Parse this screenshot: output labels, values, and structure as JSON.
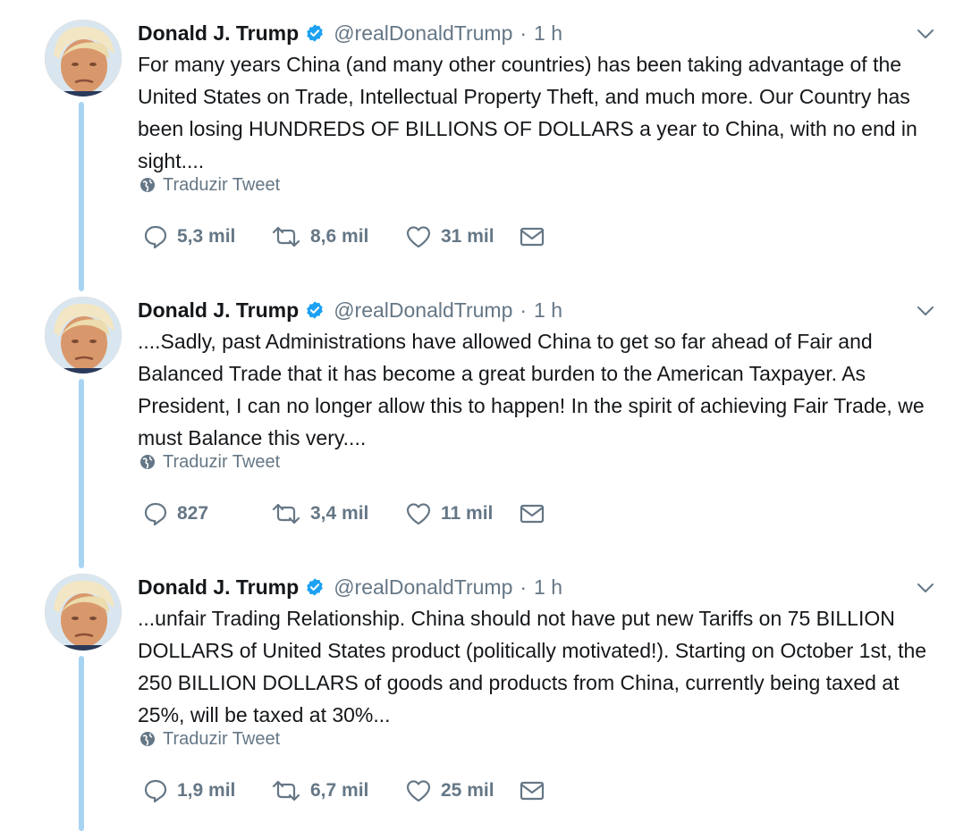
{
  "colors": {
    "thread_line": "#a8d4f3",
    "verified": "#1da1f2",
    "secondary_text": "#657786",
    "primary_text": "#14171a"
  },
  "icons": {
    "reply": "reply-icon",
    "retweet": "retweet-icon",
    "like": "like-icon",
    "dm": "direct-message-icon",
    "translate": "globe-icon",
    "menu": "chevron-down-icon",
    "verified": "verified-badge-icon"
  },
  "tweets": [
    {
      "name": "Donald J. Trump",
      "handle": "@realDonaldTrump",
      "separator": "·",
      "time": "1 h",
      "text": "For many years China (and many other countries) has been taking advantage of the United States on Trade, Intellectual Property Theft, and much more. Our Country has been losing HUNDREDS OF BILLIONS OF DOLLARS a year to China, with no end in sight....",
      "translate_label": "Traduzir Tweet",
      "replies": "5,3 mil",
      "retweets": "8,6 mil",
      "likes": "31 mil"
    },
    {
      "name": "Donald J. Trump",
      "handle": "@realDonaldTrump",
      "separator": "·",
      "time": "1 h",
      "text": "....Sadly, past Administrations have allowed China to get so far ahead of Fair and Balanced Trade that it has become a great burden to the American Taxpayer. As President, I can no longer allow this to happen! In the spirit of achieving Fair Trade, we must Balance this very....",
      "translate_label": "Traduzir Tweet",
      "replies": "827",
      "retweets": "3,4 mil",
      "likes": "11 mil"
    },
    {
      "name": "Donald J. Trump",
      "handle": "@realDonaldTrump",
      "separator": "·",
      "time": "1 h",
      "text": "...unfair Trading Relationship. China should not have put new Tariffs on 75 BILLION DOLLARS of United States product (politically motivated!). Starting on October 1st, the 250 BILLION DOLLARS of goods and products from China, currently being taxed at 25%, will be taxed at 30%...",
      "translate_label": "Traduzir Tweet",
      "replies": "1,9 mil",
      "retweets": "6,7 mil",
      "likes": "25 mil"
    }
  ]
}
